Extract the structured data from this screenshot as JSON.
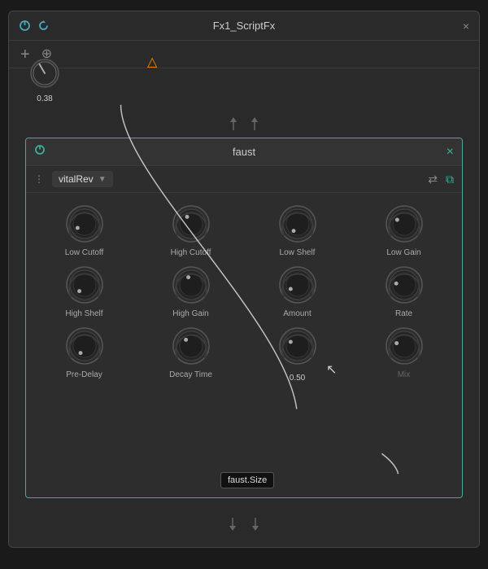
{
  "window": {
    "title": "Fx1_ScriptFx",
    "close_label": "×"
  },
  "outer_toolbar": {
    "add_label": "+",
    "move_label": "⊕"
  },
  "top_knob": {
    "value": "0.38"
  },
  "plugin": {
    "title": "faust",
    "close_label": "×",
    "preset_name": "vitalRev",
    "knobs": [
      {
        "id": "low-cutoff",
        "label": "Low Cutoff",
        "value": null,
        "angle": -120
      },
      {
        "id": "high-cutoff",
        "label": "High Cutoff",
        "value": null,
        "angle": -30
      },
      {
        "id": "low-shelf",
        "label": "Low Shelf",
        "value": null,
        "angle": -150
      },
      {
        "id": "low-gain",
        "label": "Low Gain",
        "value": null,
        "angle": -60
      },
      {
        "id": "high-shelf",
        "label": "High Shelf",
        "value": null,
        "angle": -140
      },
      {
        "id": "high-gain",
        "label": "High Gain",
        "value": null,
        "angle": -20
      },
      {
        "id": "amount",
        "label": "Amount",
        "value": null,
        "angle": -120
      },
      {
        "id": "rate",
        "label": "Rate",
        "value": null,
        "angle": -80
      },
      {
        "id": "pre-delay",
        "label": "Pre-Delay",
        "value": null,
        "angle": -150
      },
      {
        "id": "decay-time",
        "label": "Decay Time",
        "value": null,
        "angle": -40
      },
      {
        "id": "size",
        "label": "0.50",
        "value": "0.50",
        "angle": -60
      },
      {
        "id": "mix",
        "label": "Mix",
        "value": null,
        "angle": -70
      }
    ]
  },
  "tooltip": {
    "text": "faust.Size"
  },
  "icons": {
    "power": "⏻",
    "warning": "⚠",
    "link": "⧉",
    "shuffle": "⇄",
    "dots": "⋮",
    "arrow_down": "↓",
    "arrow_up": "↑"
  }
}
